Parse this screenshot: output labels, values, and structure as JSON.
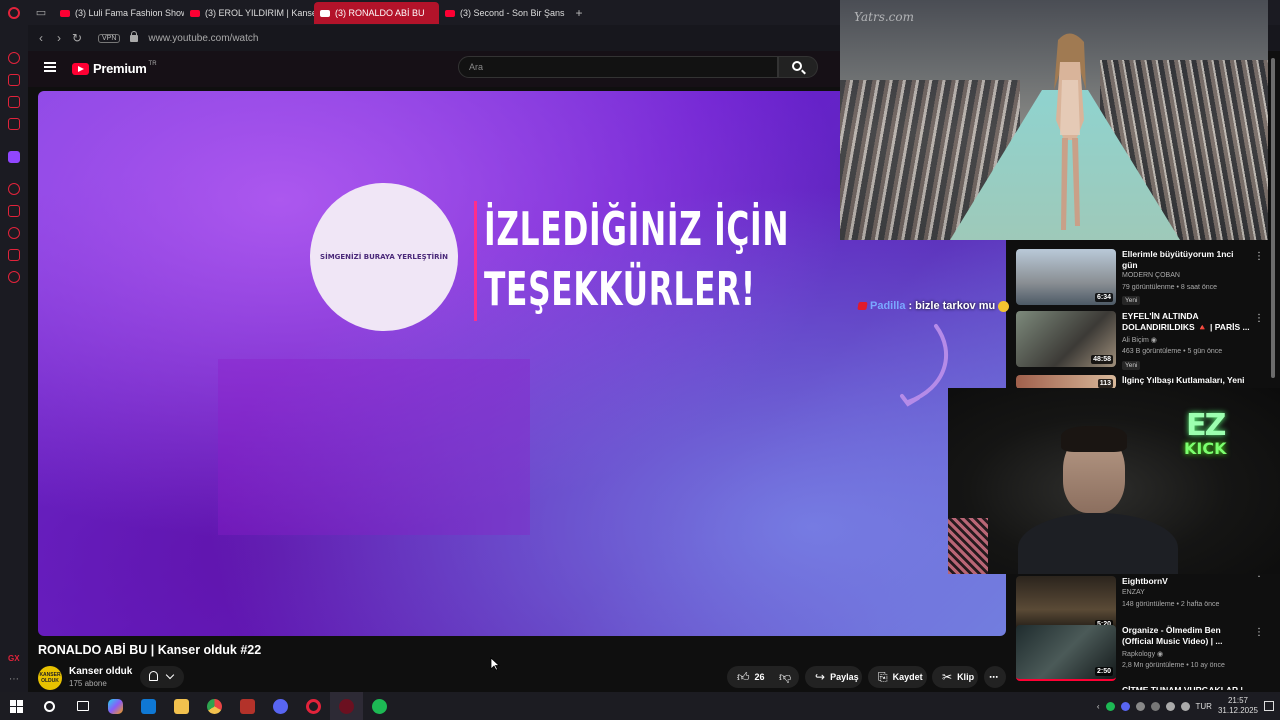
{
  "browser": {
    "tabs": [
      {
        "label": "(3) Luli Fama Fashion Show",
        "active": false
      },
      {
        "label": "(3) EROL YILDIRIM | Kanser",
        "active": false
      },
      {
        "label": "(3) RONALDO ABİ BU",
        "active": true
      },
      {
        "label": "(3) Second - Son Bir Şans",
        "active": false
      }
    ],
    "new_tab": "+",
    "vpn_label": "VPN",
    "url": "www.youtube.com/watch",
    "sidebar_footer": "GX"
  },
  "youtube": {
    "logo_text": "Premium",
    "logo_region": "TR",
    "search_placeholder": "Ara"
  },
  "video": {
    "subscribe_circle_text": "SİMGENİZİ BURAYA YERLEŞTİRİN",
    "thanks_text": "İZLEDİĞİNİZ İÇİN\nTEŞEKKÜRLER!",
    "chat": {
      "user": "Padilla",
      "separator": ":",
      "message": "bizle tarkov mu"
    },
    "title": "RONALDO ABİ BU | Kanser olduk #22",
    "channel": {
      "name": "Kanser olduk",
      "subs": "175 abone",
      "avatar_text": "KANSER OLDUK"
    },
    "actions": {
      "likes": "26",
      "share": "Paylaş",
      "save": "Kaydet",
      "clip": "Klip",
      "more": "⋯"
    }
  },
  "recommendations": [
    {
      "title": "Ellerimle büyütüyorum 1nci gün",
      "channel": "MODERN ÇOBAN",
      "meta": "79 görüntülenme • 8 saat önce",
      "badge": "Yeni",
      "duration": "6:34",
      "thumb_color": "#8fa7c0"
    },
    {
      "title": "EYFEL'İN ALTINDA DOLANDIRILDIKS 🔺 | PARİS ...",
      "channel": "Ali Biçim",
      "verified": true,
      "meta": "463 B görüntüleme • 5 gün önce",
      "badge": "Yeni",
      "duration": "48:58",
      "thumb_color": "#6b7a6a"
    },
    {
      "title": "İlginç Yılbaşı Kutlamaları, Yeni",
      "duration": "113",
      "thumb_color": "#9a5c48"
    },
    {
      "title": "EightbornV",
      "channel": "ENZAY",
      "meta": "148 görüntüleme • 2 hafta önce",
      "duration": "5:20",
      "thumb_color": "#3a3026"
    },
    {
      "title": "Organize - Ölmedim Ben (Official Music Video) | ...",
      "channel": "Rapkology",
      "verified": true,
      "meta": "2,8 Mn görüntüleme • 10 ay önce",
      "duration": "2:50",
      "thumb_color": "#2b3a3a"
    },
    {
      "title": "ÇİTME TUNAM VURGAKLAR |",
      "thumb_color": "#444"
    }
  ],
  "overlays": {
    "runway_watermark": "Yatrs.com",
    "kick_top": "EZ",
    "kick_bottom": "KICK"
  },
  "taskbar": {
    "apps": [
      {
        "name": "search",
        "color": "#ffffff"
      },
      {
        "name": "task-view",
        "color": "#ffffff"
      },
      {
        "name": "copilot",
        "color": "#3b8bff"
      },
      {
        "name": "edge",
        "color": "#1e90ff"
      },
      {
        "name": "file-explorer",
        "color": "#f2c14e"
      },
      {
        "name": "browser",
        "color": "#e84545"
      },
      {
        "name": "voicemeeter",
        "color": "#c0392b"
      },
      {
        "name": "discord",
        "color": "#5865f2"
      },
      {
        "name": "opera",
        "color": "#e2233b"
      },
      {
        "name": "opera-gx",
        "color": "#9e1b2c"
      },
      {
        "name": "spotify",
        "color": "#1db954"
      }
    ],
    "language": "TUR",
    "time": "21:57",
    "date": "31.12.2025"
  }
}
